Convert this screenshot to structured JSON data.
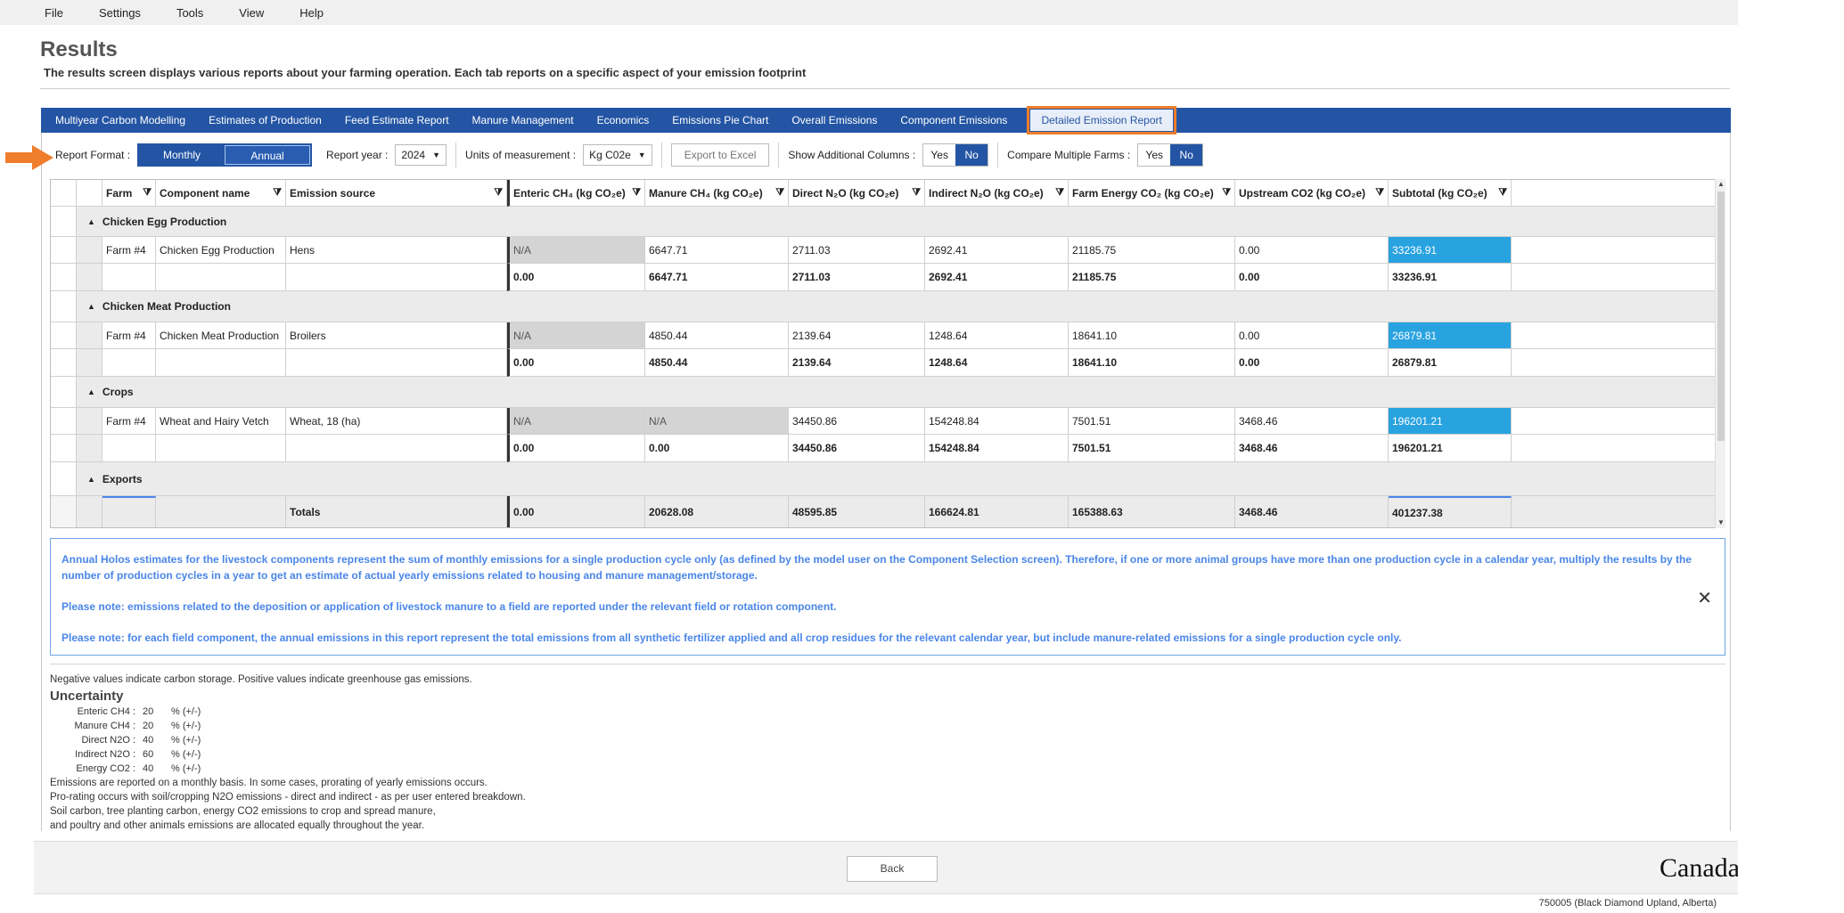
{
  "menu": [
    "File",
    "Settings",
    "Tools",
    "View",
    "Help"
  ],
  "page": {
    "title": "Results",
    "subtitle": "The results screen displays various reports about your farming operation. Each tab reports on a specific aspect of your emission footprint"
  },
  "tabs": [
    "Multiyear Carbon Modelling",
    "Estimates of Production",
    "Feed Estimate Report",
    "Manure Management",
    "Economics",
    "Emissions Pie Chart",
    "Overall Emissions",
    "Component Emissions",
    "Detailed Emission Report"
  ],
  "active_tab": "Detailed Emission Report",
  "toolbar": {
    "report_format_label": "Report Format :",
    "monthly": "Monthly",
    "annual": "Annual",
    "report_year_label": "Report year :",
    "report_year": "2024",
    "units_label": "Units of measurement :",
    "units": "Kg C02e",
    "export": "Export to Excel",
    "additional_columns_label": "Show Additional Columns :",
    "compare_label": "Compare Multiple Farms :",
    "yes": "Yes",
    "no": "No"
  },
  "grid": {
    "headers": {
      "farm": "Farm",
      "component": "Component name",
      "source": "Emission source",
      "enteric": "Enteric CH₄ (kg CO₂e)",
      "manure": "Manure CH₄ (kg CO₂e)",
      "direct": "Direct N₂O (kg CO₂e)",
      "indirect": "Indirect N₂O (kg CO₂e)",
      "energy": "Farm Energy CO₂ (kg CO₂e)",
      "upstream": "Upstream CO2 (kg CO₂e)",
      "subtotal": "Subtotal (kg CO₂e)"
    },
    "groups": [
      {
        "title": "Chicken Egg Production",
        "row": {
          "farm": "Farm #4",
          "component": "Chicken Egg Production",
          "source": "Hens",
          "enteric": "N/A",
          "manure": "6647.71",
          "direct": "2711.03",
          "indirect": "2692.41",
          "energy": "21185.75",
          "upstream": "0.00",
          "subtotal": "33236.91"
        },
        "total": {
          "enteric": "0.00",
          "manure": "6647.71",
          "direct": "2711.03",
          "indirect": "2692.41",
          "energy": "21185.75",
          "upstream": "0.00",
          "subtotal": "33236.91"
        }
      },
      {
        "title": "Chicken Meat Production",
        "row": {
          "farm": "Farm #4",
          "component": "Chicken Meat Production",
          "source": "Broilers",
          "enteric": "N/A",
          "manure": "4850.44",
          "direct": "2139.64",
          "indirect": "1248.64",
          "energy": "18641.10",
          "upstream": "0.00",
          "subtotal": "26879.81"
        },
        "total": {
          "enteric": "0.00",
          "manure": "4850.44",
          "direct": "2139.64",
          "indirect": "1248.64",
          "energy": "18641.10",
          "upstream": "0.00",
          "subtotal": "26879.81"
        }
      },
      {
        "title": "Crops",
        "row": {
          "farm": "Farm #4",
          "component": "Wheat and Hairy Vetch",
          "source": "Wheat, 18 (ha)",
          "enteric": "N/A",
          "manure": "N/A",
          "direct": "34450.86",
          "indirect": "154248.84",
          "energy": "7501.51",
          "upstream": "3468.46",
          "subtotal": "196201.21"
        },
        "total": {
          "enteric": "0.00",
          "manure": "0.00",
          "direct": "34450.86",
          "indirect": "154248.84",
          "energy": "7501.51",
          "upstream": "3468.46",
          "subtotal": "196201.21"
        }
      }
    ],
    "exports_title": "Exports",
    "totals": {
      "label": "Totals",
      "enteric": "0.00",
      "manure": "20628.08",
      "direct": "48595.85",
      "indirect": "166624.81",
      "energy": "165388.63",
      "upstream": "3468.46",
      "subtotal": "401237.38"
    }
  },
  "notes": [
    "Annual Holos estimates for the livestock components represent the sum of monthly emissions for a single production cycle only (as defined by the model user on the Component Selection screen). Therefore, if one or more animal groups have more than one production cycle in a calendar year, multiply the results by the number of production cycles in a year to get an estimate of actual yearly emissions related to housing and manure management/storage.",
    "Please note: emissions related to the deposition or application of livestock manure to a field are reported under the relevant field or rotation component.",
    "Please note: for each field component, the annual emissions in this report represent the total emissions from all synthetic fertilizer applied and all crop residues for the relevant calendar year, but include manure-related emissions for a single production cycle only."
  ],
  "info": {
    "storage_note": "Negative values indicate carbon storage. Positive values indicate greenhouse gas emissions.",
    "uncertainty_title": "Uncertainty",
    "uncertainty": [
      {
        "label": "Enteric CH4 :",
        "value": "20",
        "unit": "% (+/-)"
      },
      {
        "label": "Manure CH4 :",
        "value": "20",
        "unit": "% (+/-)"
      },
      {
        "label": "Direct N2O :",
        "value": "40",
        "unit": "% (+/-)"
      },
      {
        "label": "Indirect N2O :",
        "value": "60",
        "unit": "% (+/-)"
      },
      {
        "label": "Energy CO2 :",
        "value": "40",
        "unit": "% (+/-)"
      }
    ],
    "lines": [
      "Emissions are reported on a monthly basis. In some cases, prorating of yearly emissions occurs.",
      "Pro-rating occurs with soil/cropping N2O emissions - direct and indirect - as per user entered breakdown.",
      "Soil carbon, tree planting carbon, energy CO2 emissions to crop and spread manure,",
      "and poultry and other animals emissions are allocated equally throughout the year."
    ]
  },
  "footer": {
    "back": "Back",
    "canada": "Canada",
    "location": "750005 (Black Diamond Upland, Alberta)"
  },
  "colors": {
    "accent": "#2455a4",
    "highlight": "#29a3e0",
    "tab_outline": "#ef7d2c",
    "note_text": "#4a86e8"
  }
}
